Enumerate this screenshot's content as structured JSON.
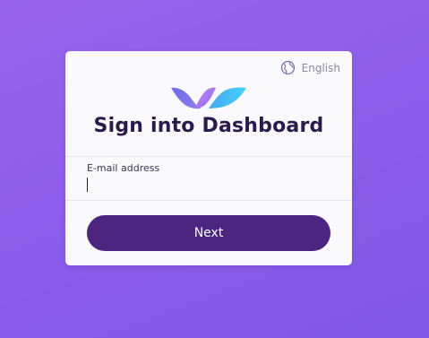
{
  "language": {
    "label": "English",
    "icon": "globe-icon"
  },
  "logo": {
    "icon": "wave-logo",
    "colors": [
      "#7b6cf0",
      "#b07af5",
      "#3fb4f7"
    ]
  },
  "title": "Sign into Dashboard",
  "form": {
    "email_label": "E-mail address",
    "email_value": "",
    "next_label": "Next"
  },
  "colors": {
    "accent": "#4b2580",
    "title": "#2a1a4d",
    "background_start": "#9763ec",
    "background_end": "#7f58e6"
  }
}
